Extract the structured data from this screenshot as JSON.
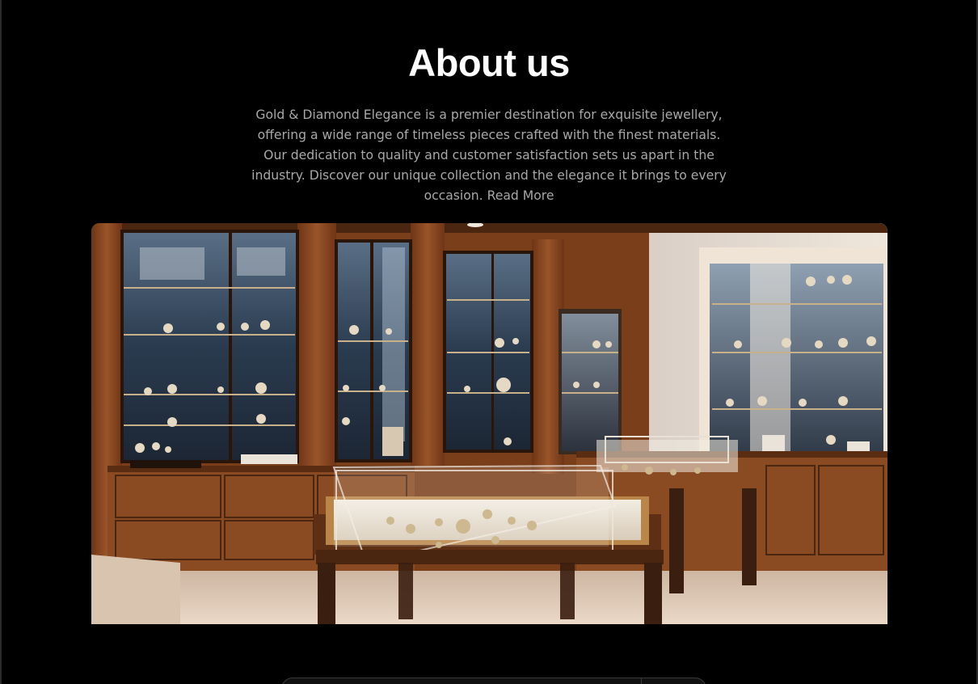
{
  "section": {
    "title": "About us",
    "description": "Gold & Diamond Elegance is a premier destination for exquisite jewellery, offering a wide range of timeless pieces crafted with the finest materials. Our dedication to quality and customer satisfaction sets us apart in the industry. Discover our unique collection and the elegance it brings to every occasion.",
    "read_more": "Read More"
  },
  "colors": {
    "background": "#000000",
    "title": "#ffffff",
    "body_text": "#a8a8a8",
    "wood": "#8a4a22",
    "glass": "#2b3d52"
  }
}
